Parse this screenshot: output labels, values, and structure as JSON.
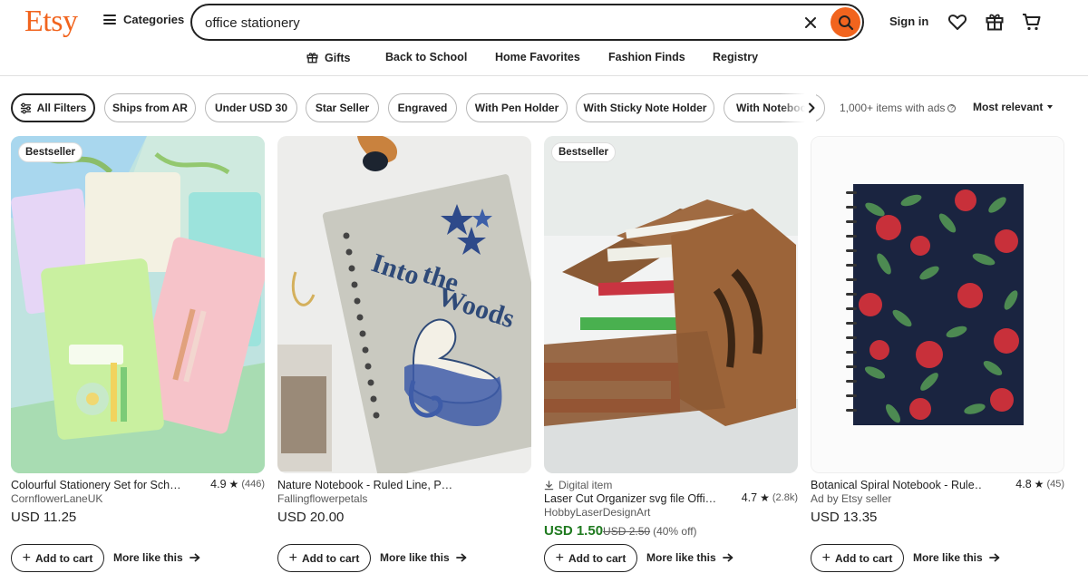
{
  "header": {
    "logo": "Etsy",
    "categories_label": "Categories",
    "search_value": "office stationery",
    "sign_in": "Sign in"
  },
  "nav": [
    "Gifts",
    "Back to School",
    "Home Favorites",
    "Fashion Finds",
    "Registry"
  ],
  "filters": {
    "all_filters": "All Filters",
    "chips": [
      "Ships from AR",
      "Under USD 30",
      "Star Seller",
      "Engraved",
      "With Pen Holder",
      "With Sticky Note Holder",
      "With Notebook"
    ],
    "ads_note": "1,000+ items with ads",
    "sort": "Most relevant"
  },
  "products": [
    {
      "badge": "Bestseller",
      "title": "Colourful Stationery Set for Sch…",
      "rating": "4.9",
      "reviews": "(446)",
      "seller": "CornflowerLaneUK",
      "price": "USD 11.25",
      "add_to_cart": "Add to cart",
      "more_like": "More like this"
    },
    {
      "title": "Nature Notebook - Ruled Line, P…",
      "seller": "Fallingflowerpetals",
      "price": "USD 20.00",
      "add_to_cart": "Add to cart",
      "more_like": "More like this",
      "image_text": [
        "Into",
        "the",
        "Woods"
      ]
    },
    {
      "badge": "Bestseller",
      "digital_label": "Digital item",
      "title": "Laser Cut Organizer svg file Offi…",
      "rating": "4.7",
      "reviews": "(2.8k)",
      "seller": "HobbyLaserDesignArt",
      "price": "USD 1.50",
      "original_price": "USD 2.50",
      "discount": "(40% off)",
      "add_to_cart": "Add to cart",
      "more_like": "More like this"
    },
    {
      "title": "Botanical Spiral Notebook - Rule…",
      "rating": "4.8",
      "reviews": "(45)",
      "seller": "Ad by Etsy seller",
      "price": "USD 13.35",
      "add_to_cart": "Add to cart",
      "more_like": "More like this"
    }
  ],
  "colors": {
    "brand": "#f1641e",
    "sale_price": "#1f7a1f"
  }
}
